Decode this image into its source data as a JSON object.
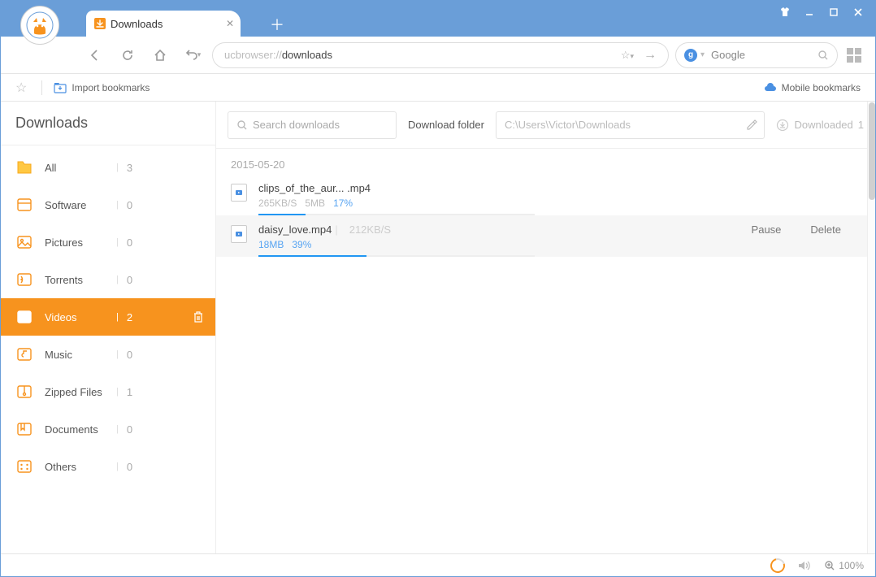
{
  "window": {
    "tab_title": "Downloads",
    "shirt_icon": "tshirt-icon",
    "minimize": "minimize",
    "maximize": "maximize",
    "close": "close"
  },
  "toolbar": {
    "url_prefix": "ucbrowser://",
    "url_path": "downloads",
    "search_engine": "Google"
  },
  "bookmarks": {
    "import_label": "Import bookmarks",
    "mobile_label": "Mobile bookmarks"
  },
  "downloads": {
    "heading": "Downloads",
    "search_placeholder": "Search downloads",
    "folder_label": "Download folder",
    "folder_path": "C:\\Users\\Victor\\Downloads",
    "downloaded_label": "Downloaded",
    "downloaded_count": "1"
  },
  "categories": [
    {
      "name": "All",
      "count": "3",
      "icon": "folder",
      "active": false
    },
    {
      "name": "Software",
      "count": "0",
      "icon": "software",
      "active": false
    },
    {
      "name": "Pictures",
      "count": "0",
      "icon": "pictures",
      "active": false
    },
    {
      "name": "Torrents",
      "count": "0",
      "icon": "torrents",
      "active": false
    },
    {
      "name": "Videos",
      "count": "2",
      "icon": "videos",
      "active": true
    },
    {
      "name": "Music",
      "count": "0",
      "icon": "music",
      "active": false
    },
    {
      "name": "Zipped Files",
      "count": "1",
      "icon": "zip",
      "active": false
    },
    {
      "name": "Documents",
      "count": "0",
      "icon": "documents",
      "active": false
    },
    {
      "name": "Others",
      "count": "0",
      "icon": "others",
      "active": false
    }
  ],
  "list": {
    "date": "2015-05-20",
    "items": [
      {
        "name": "clips_of_the_aur... .mp4",
        "speed": "265KB/S",
        "size": "5MB",
        "percent": "17%",
        "progress": 17,
        "hover": false
      },
      {
        "name": "daisy_love.mp4",
        "speed": "212KB/S",
        "size": "18MB",
        "percent": "39%",
        "progress": 39,
        "hover": true
      }
    ],
    "actions": {
      "pause": "Pause",
      "delete": "Delete"
    }
  },
  "status": {
    "zoom": "100%"
  }
}
